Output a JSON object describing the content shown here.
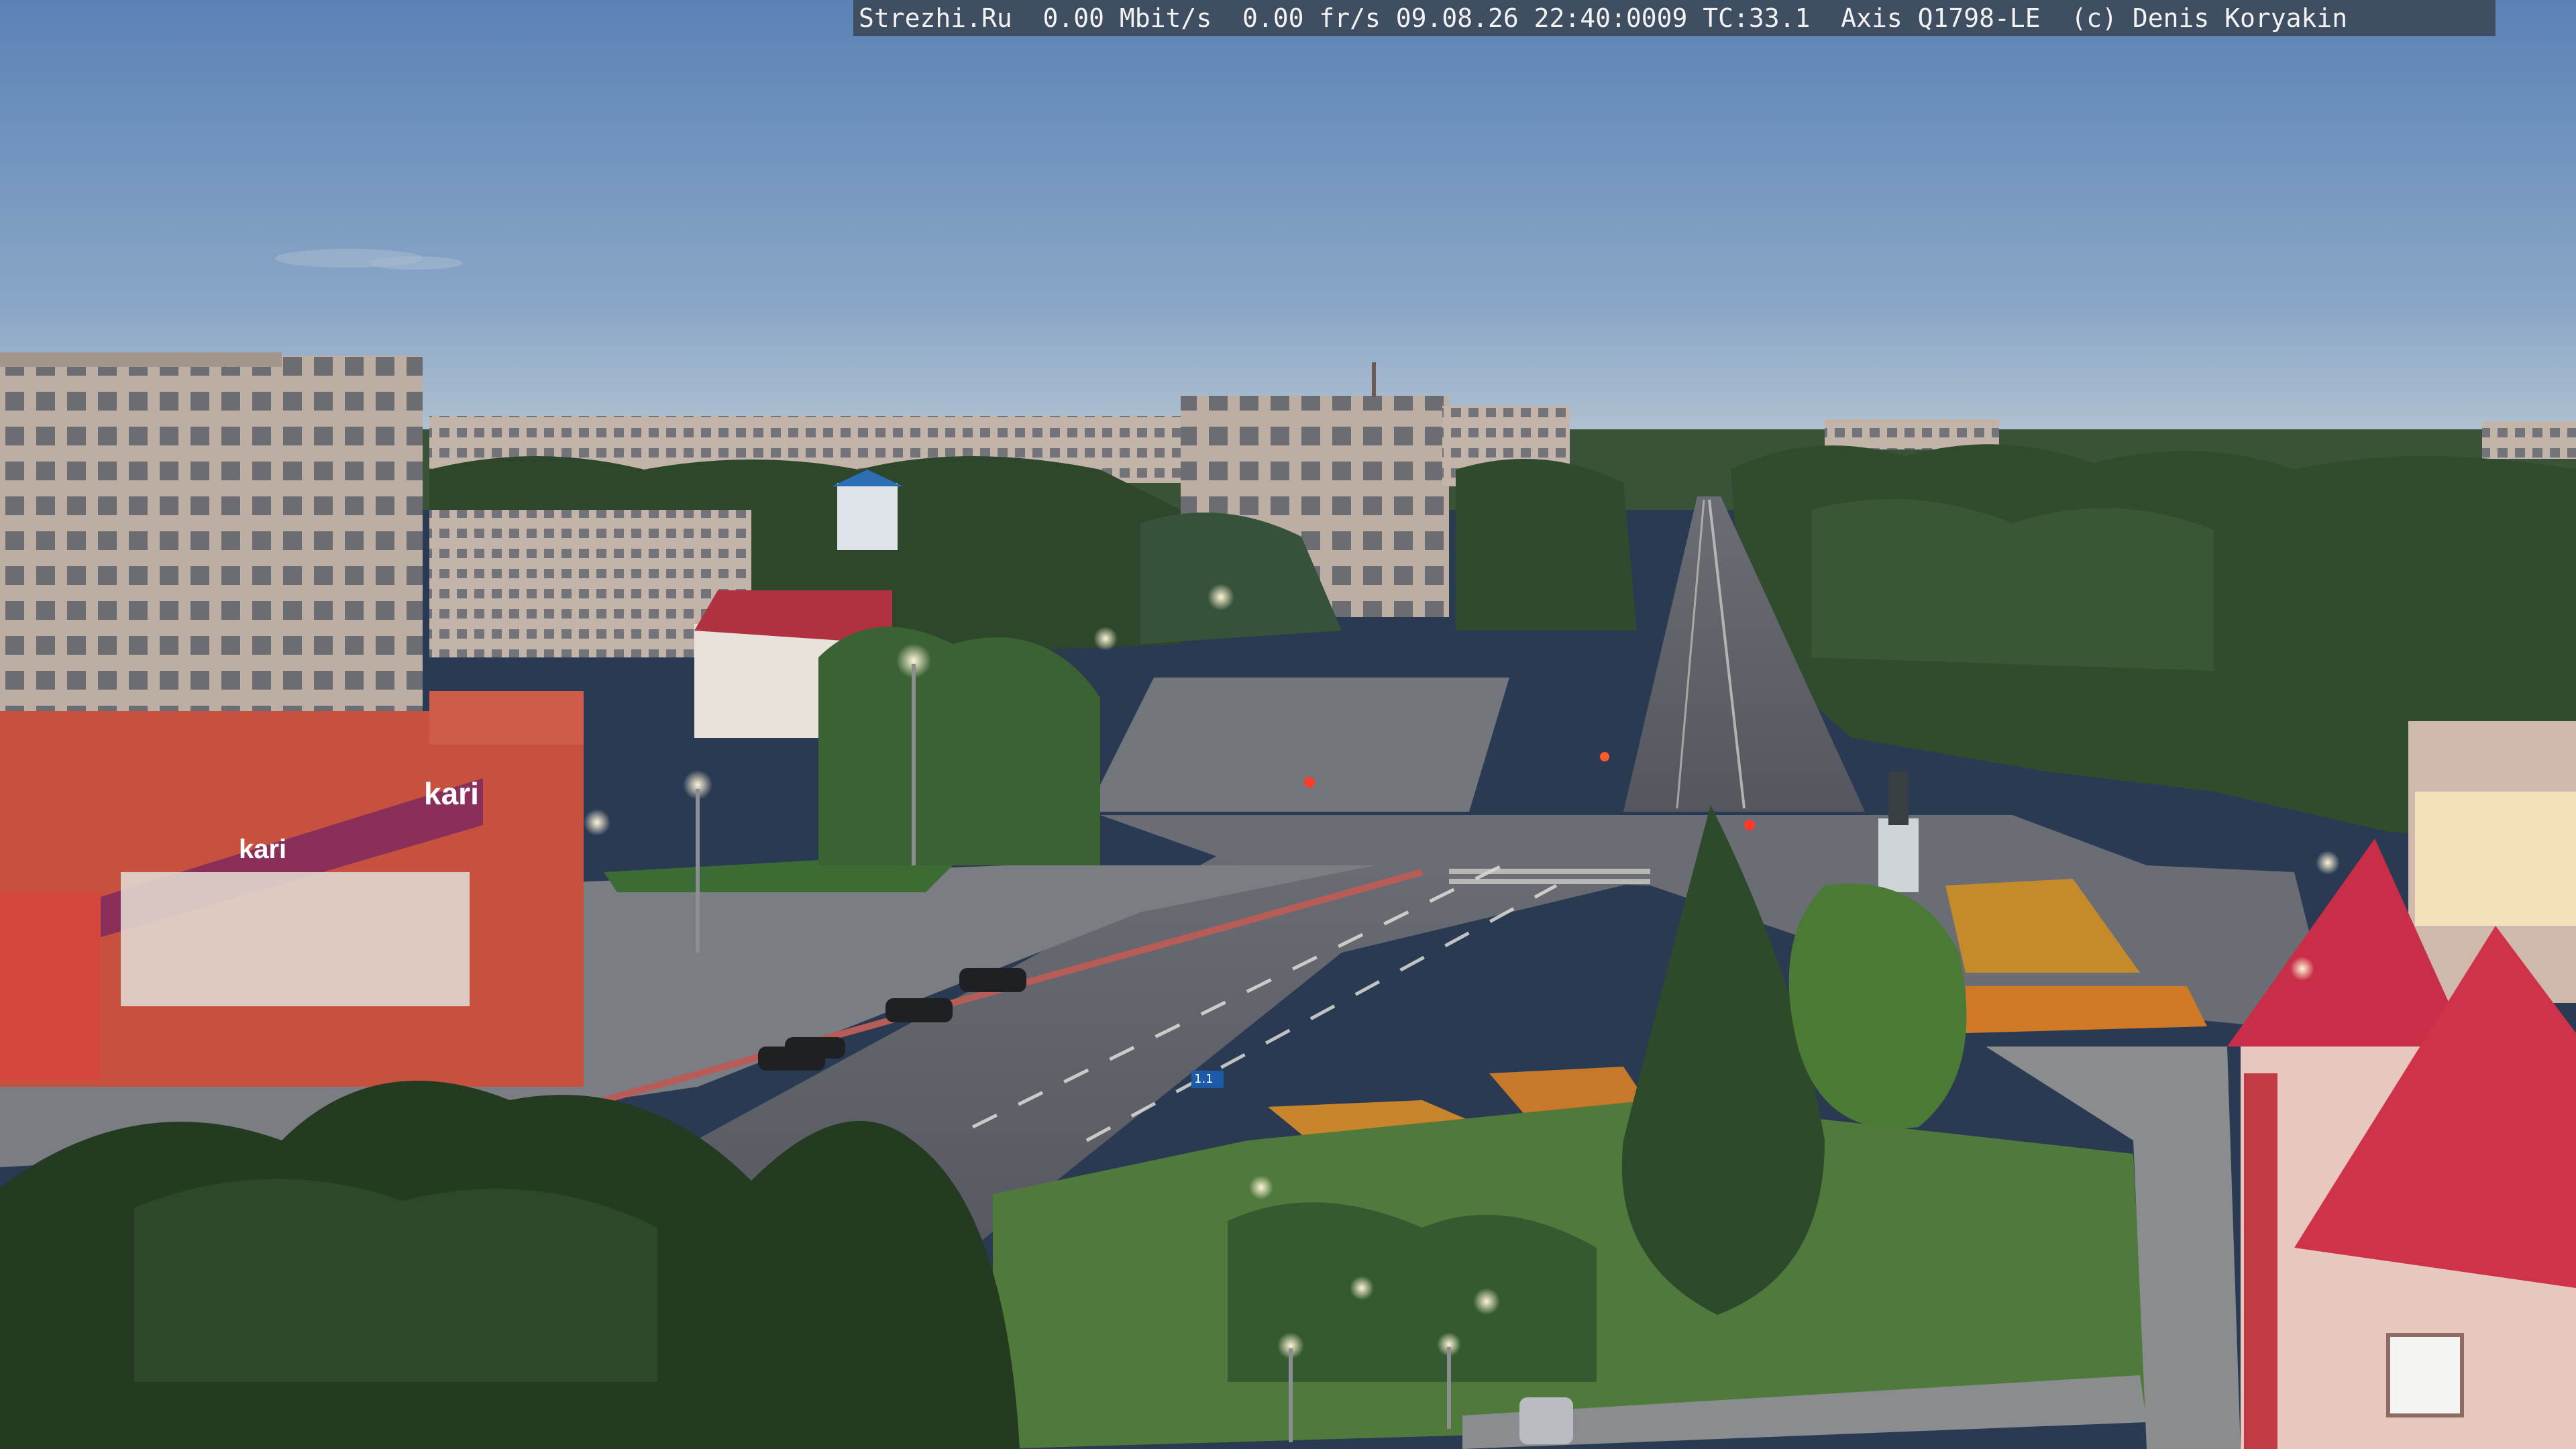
{
  "camera": {
    "overlay_text": "Strezhi.Ru  0.00 Mbit/s  0.00 fr/s 09.08.26 22:40:0009 TC:33.1  Axis Q1798-LE  (c) Denis Koryakin"
  },
  "signage": {
    "store_sign": "kari",
    "store_sign_small": "kari",
    "road_sign": "1.1"
  },
  "colors": {
    "sky_top": "#5f86b8",
    "sky_horizon": "#a9bfd4",
    "forest": "#2f4a2e",
    "road": "#5c6168",
    "building_brick": "#b8a89c",
    "building_red": "#c7513f",
    "roof_red": "#d23a4e",
    "store_band": "#8a2f5a"
  }
}
